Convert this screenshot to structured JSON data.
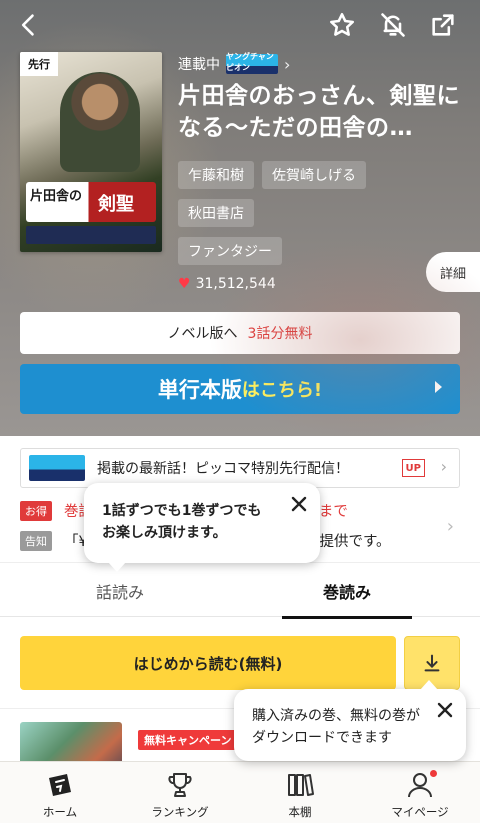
{
  "header": {
    "back_icon": "chevron-left-icon",
    "favorite_icon": "star-icon",
    "notification_icon": "bell-off-icon",
    "share_icon": "share-icon"
  },
  "cover": {
    "badge": "先行",
    "title_left": "片田舎の",
    "title_right": "剣聖"
  },
  "work": {
    "status": "連載中",
    "magazine_logo_text": "ヤングチャンピオン",
    "title": "片田舎のおっさん、剣聖になる〜ただの田舎の…",
    "tags": [
      "乍藤和樹",
      "佐賀崎しげる",
      "秋田書店",
      "ファンタジー"
    ],
    "likes": "31,512,544",
    "detail_label": "詳細"
  },
  "novel_link": {
    "label": "ノベル版へ",
    "highlight": "3話分無料"
  },
  "tankobon_button": {
    "label": "単行本版",
    "suffix": "はこちら!"
  },
  "banner": {
    "text": "掲載の最新話！ピッコマ特別先行配信！",
    "badge": "UP"
  },
  "notices": [
    {
      "label": "お得",
      "label_color": "#e03a3a",
      "text_start": "巻読",
      "text_end": "9 まで"
    },
    {
      "label": "告知",
      "label_color": "#9a9a9a",
      "text_start": "「¥0",
      "text_end": "の提供です。"
    }
  ],
  "tooltip_top": {
    "line1": "1話ずつでも1巻ずつでも",
    "line2": "お楽しみ頂けます。"
  },
  "tabs": [
    {
      "label": "話読み",
      "active": false
    },
    {
      "label": "巻読み",
      "active": true
    }
  ],
  "read_button": "はじめから読む(無料)",
  "tooltip_download": {
    "line1": "購入済みの巻、無料の巻が",
    "line2": "ダウンロードできます"
  },
  "list_preview": {
    "campaign_badge": "無料キャンペーン"
  },
  "bottom_nav": [
    {
      "label": "ホーム",
      "icon": "home-icon"
    },
    {
      "label": "ランキング",
      "icon": "trophy-icon"
    },
    {
      "label": "本棚",
      "icon": "bookshelf-icon"
    },
    {
      "label": "マイページ",
      "icon": "user-icon"
    }
  ],
  "colors": {
    "accent_yellow": "#ffd43b",
    "tankobon_blue": "#1e8fd0",
    "alert_red": "#e03a3a"
  }
}
